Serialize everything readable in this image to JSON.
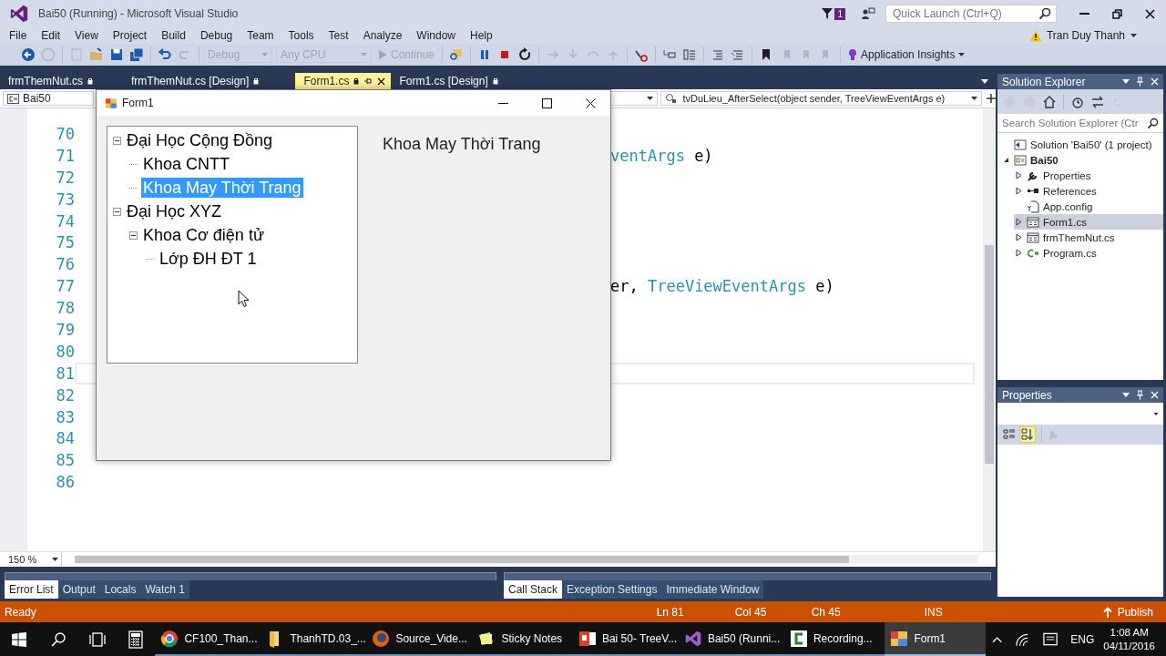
{
  "window": {
    "title": "Bai50 (Running) - Microsoft Visual Studio",
    "notification_count": "1",
    "quick_launch": {
      "placeholder": "Quick Launch (Ctrl+Q)"
    }
  },
  "menu": [
    "File",
    "Edit",
    "View",
    "Project",
    "Build",
    "Debug",
    "Team",
    "Tools",
    "Test",
    "Analyze",
    "Window",
    "Help"
  ],
  "user": {
    "name": "Tran Duy Thanh"
  },
  "toolbar": {
    "dropdowns": [
      {
        "label": "Debug",
        "disabled": true
      },
      {
        "label": "Any CPU",
        "disabled": true
      }
    ],
    "continue": {
      "label": "Continue",
      "disabled": true
    },
    "insights": {
      "label": "Application Insights"
    }
  },
  "document_tabs": [
    {
      "label": "frmThemNut.cs",
      "selected": false
    },
    {
      "label": "frmThemNut.cs [Design]",
      "selected": false
    },
    {
      "label": "Form1.cs",
      "selected": true
    },
    {
      "label": "Form1.cs [Design]",
      "selected": false
    }
  ],
  "editor": {
    "project": "Bai50",
    "member": "tvDuLieu_AfterSelect(object sender, TreeViewEventArgs e)",
    "zoom": "150 %",
    "lines": [
      {
        "number": "70"
      },
      {
        "number": "71",
        "segments": [
          {
            "text": "ventArgs",
            "kind": "type"
          },
          {
            "text": " e)",
            "kind": "plain"
          }
        ]
      },
      {
        "number": "72"
      },
      {
        "number": "73"
      },
      {
        "number": "74"
      },
      {
        "number": "75"
      },
      {
        "number": "76"
      },
      {
        "number": "77",
        "segments": [
          {
            "text": "er, ",
            "kind": "plain"
          },
          {
            "text": "TreeViewEventArgs",
            "kind": "type"
          },
          {
            "text": " e)",
            "kind": "plain"
          }
        ]
      },
      {
        "number": "78"
      },
      {
        "number": "79"
      },
      {
        "number": "80"
      },
      {
        "number": "81",
        "current": true
      },
      {
        "number": "82"
      },
      {
        "number": "83"
      },
      {
        "number": "84"
      },
      {
        "number": "85"
      },
      {
        "number": "86"
      }
    ]
  },
  "form_window": {
    "title": "Form1",
    "label": "Khoa May Thời Trang",
    "tree": [
      {
        "label": "Đại Học Cộng Đồng",
        "expanded": true,
        "selected": false,
        "children": [
          {
            "label": "Khoa CNTT",
            "selected": false
          },
          {
            "label": "Khoa May Thời Trang",
            "selected": true
          }
        ]
      },
      {
        "label": "Đại Học XYZ",
        "expanded": true,
        "selected": false,
        "children": [
          {
            "label": "Khoa Cơ điện tử",
            "expanded": true,
            "selected": false,
            "children": [
              {
                "label": "Lớp ĐH ĐT 1",
                "selected": false
              }
            ]
          }
        ]
      }
    ]
  },
  "solution_explorer": {
    "title": "Solution Explorer",
    "search": {
      "placeholder": "Search Solution Explorer (Ctr"
    },
    "tree": [
      {
        "label": "Solution 'Bai50' (1 project)",
        "kind": "solution",
        "has_expander": false,
        "expanded": true,
        "selected": false,
        "bold": false,
        "children": [
          {
            "label": "Bai50",
            "kind": "project",
            "has_expander": true,
            "expanded": true,
            "selected": false,
            "bold": true,
            "children": [
              {
                "label": "Properties",
                "kind": "wrench",
                "has_expander": true,
                "selected": false,
                "bold": false
              },
              {
                "label": "References",
                "kind": "references",
                "has_expander": true,
                "selected": false,
                "bold": false
              },
              {
                "label": "App.config",
                "kind": "config",
                "has_expander": false,
                "selected": false,
                "bold": false
              },
              {
                "label": "Form1.cs",
                "kind": "form",
                "has_expander": true,
                "selected": true,
                "bold": false
              },
              {
                "label": "frmThemNut.cs",
                "kind": "form",
                "has_expander": true,
                "selected": false,
                "bold": false
              },
              {
                "label": "Program.cs",
                "kind": "csfile",
                "has_expander": true,
                "selected": false,
                "bold": false
              }
            ]
          }
        ]
      }
    ]
  },
  "properties": {
    "title": "Properties",
    "views": [
      {
        "kind": "categorized",
        "selected": false
      },
      {
        "kind": "alphabetical",
        "selected": true
      }
    ]
  },
  "bottom_tabs": {
    "left": [
      {
        "label": "Error List",
        "selected": true
      },
      {
        "label": "Output",
        "selected": false
      },
      {
        "label": "Locals",
        "selected": false
      },
      {
        "label": "Watch 1",
        "selected": false
      }
    ],
    "right": [
      {
        "label": "Call Stack",
        "selected": true
      },
      {
        "label": "Exception Settings",
        "selected": false
      },
      {
        "label": "Immediate Window",
        "selected": false
      }
    ]
  },
  "status_bar": {
    "state": "Ready",
    "line": "Ln 81",
    "column": "Col 45",
    "char": "Ch 45",
    "mode": "INS",
    "publish": "Publish"
  },
  "taskbar": {
    "apps": [
      {
        "label": "CF100_Than...",
        "kind": "chrome",
        "selected": false
      },
      {
        "label": "ThanhTD.03_...",
        "kind": "folder",
        "selected": false
      },
      {
        "label": "Source_Vide...",
        "kind": "firefox",
        "selected": false
      },
      {
        "label": "Sticky Notes",
        "kind": "sticky",
        "selected": false
      },
      {
        "label": "Bai 50- TreeV...",
        "kind": "powerpoint",
        "selected": false
      },
      {
        "label": "Bai50 (Runni...",
        "kind": "vs",
        "selected": false
      },
      {
        "label": "Recording...",
        "kind": "recorder",
        "selected": false
      },
      {
        "label": "Form1",
        "kind": "form",
        "selected": true
      }
    ],
    "language": "ENG",
    "time": "1:08 AM",
    "date": "04/11/2016"
  }
}
